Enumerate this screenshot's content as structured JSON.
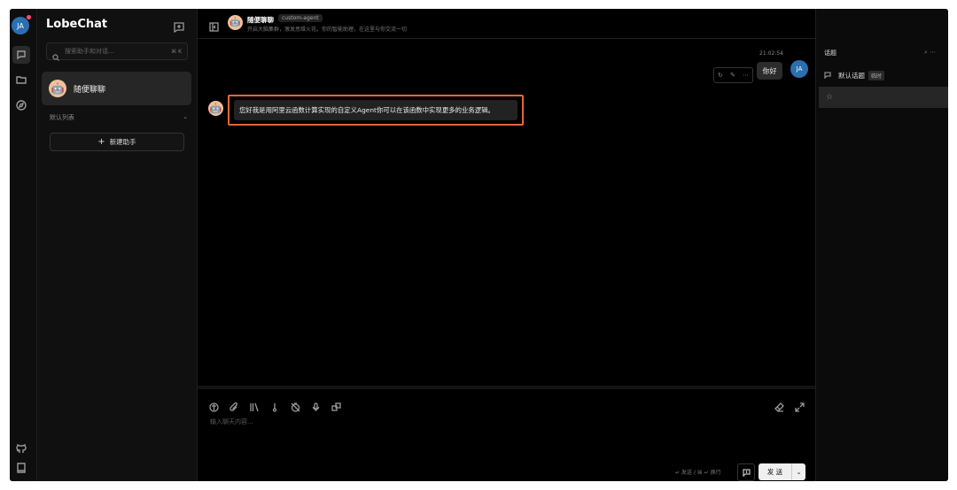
{
  "user": {
    "initials": "JA"
  },
  "sidebar": {
    "brand": "LobeChat",
    "search_placeholder": "搜索助手和对话...",
    "search_shortcut": "⌘ K",
    "active_session": {
      "title": "随便聊聊",
      "emoji": "🤖"
    },
    "group_label": "默认列表",
    "new_agent_label": "新建助手"
  },
  "chat": {
    "agent_name": "随便聊聊",
    "agent_tag": "custom-agent",
    "agent_description": "开启大脑集群，激发思维火花。你的智能助理，在这里与你交流一切",
    "messages": [
      {
        "role": "user",
        "text": "你好",
        "time": "21:02:54"
      },
      {
        "role": "assistant",
        "text": "您好我是用阿里云函数计算实现的自定义Agent你可以在该函数中实现更多的业务逻辑。"
      }
    ]
  },
  "composer": {
    "placeholder": "输入聊天内容...",
    "send_hint": "↵ 发送 / ⌘ ↵ 换行",
    "send_label": "发 送"
  },
  "topics": {
    "title": "话题",
    "default_topic": "默认话题",
    "default_badge": "临时"
  },
  "colors": {
    "highlight": "#e2673a",
    "avatar": "#2a6fb0",
    "notification": "#ff4d6a"
  }
}
